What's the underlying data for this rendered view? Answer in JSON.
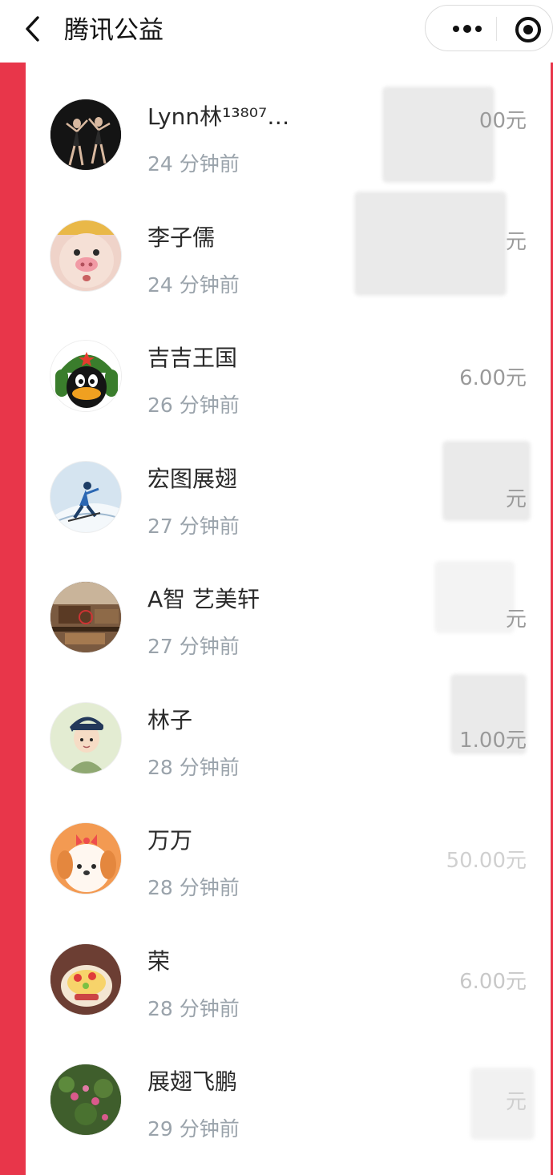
{
  "header": {
    "title": "腾讯公益"
  },
  "donations": [
    {
      "name": "Lynn林¹³⁸⁰⁷…",
      "time": "24 分钟前",
      "amount": "00元",
      "avatar": "dancers-photo"
    },
    {
      "name": "李子儒",
      "time": "24 分钟前",
      "amount": "元",
      "avatar": "pig-filter-photo"
    },
    {
      "name": "吉吉王国",
      "time": "26 分钟前",
      "amount": "6.00元",
      "avatar": "penguin-cartoon"
    },
    {
      "name": "宏图展翅",
      "time": "27 分钟前",
      "amount": "元",
      "avatar": "skier-photo"
    },
    {
      "name": "A智 艺美轩",
      "time": "27 分钟前",
      "amount": "元",
      "avatar": "furniture-photo"
    },
    {
      "name": "林子",
      "time": "28 分钟前",
      "amount": "1.00元",
      "avatar": "boy-cartoon"
    },
    {
      "name": "万万",
      "time": "28 分钟前",
      "amount": "50.00元",
      "avatar": "puppy-cartoon"
    },
    {
      "name": "荣",
      "time": "28 分钟前",
      "amount": "6.00元",
      "avatar": "cake-photo"
    },
    {
      "name": "展翅飞鹏",
      "time": "29 分钟前",
      "amount": "元",
      "avatar": "flowers-photo"
    }
  ],
  "colors": {
    "accent": "#e8364a",
    "time_text": "#9aa3ab"
  }
}
